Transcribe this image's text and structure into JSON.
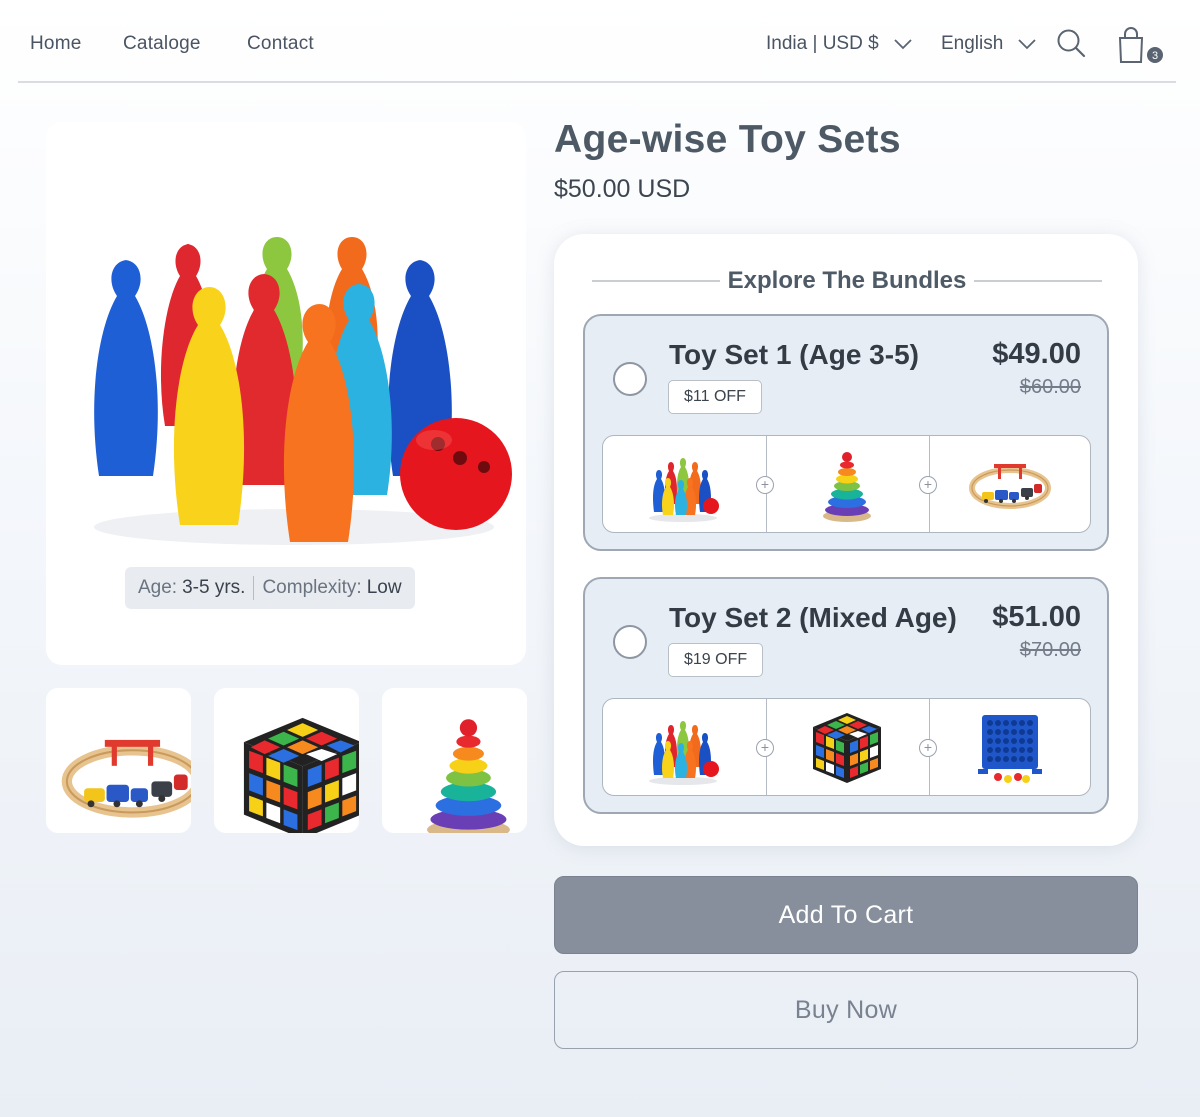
{
  "header": {
    "nav": [
      {
        "label": "Home"
      },
      {
        "label": "Cataloge"
      },
      {
        "label": "Contact"
      }
    ],
    "country_selector": "India | USD $",
    "language_selector": "English",
    "cart_count": "3",
    "icons": [
      "search-icon",
      "shopping-bag-icon",
      "chevron-down-icon"
    ]
  },
  "gallery": {
    "main_image": "bowling-pins-set",
    "age_label": "Age:",
    "age_value": "3-5 yrs.",
    "complexity_label": "Complexity:",
    "complexity_value": "Low",
    "thumbnails": [
      "wooden-train-set",
      "rubiks-cube",
      "ring-stacker"
    ]
  },
  "product": {
    "title": "Age-wise Toy Sets",
    "price": "$50.00 USD"
  },
  "bundles": {
    "heading": "Explore The Bundles",
    "items": [
      {
        "name": "Toy Set 1 (Age 3-5)",
        "price": "$49.00",
        "old_price": "$60.00",
        "discount": "$11 OFF",
        "contents": [
          "bowling-pins-set",
          "ring-stacker",
          "wooden-train-set"
        ]
      },
      {
        "name": "Toy Set 2 (Mixed Age)",
        "price": "$51.00",
        "old_price": "$70.00",
        "discount": "$19 OFF",
        "contents": [
          "bowling-pins-set",
          "rubiks-cube",
          "connect-four-game"
        ]
      }
    ]
  },
  "actions": {
    "add_to_cart": "Add To Cart",
    "buy_now": "Buy Now"
  },
  "colors": {
    "accent_button": "#868f9b",
    "text_dark": "#333b45",
    "bundle_bg": "#e7edf4"
  }
}
